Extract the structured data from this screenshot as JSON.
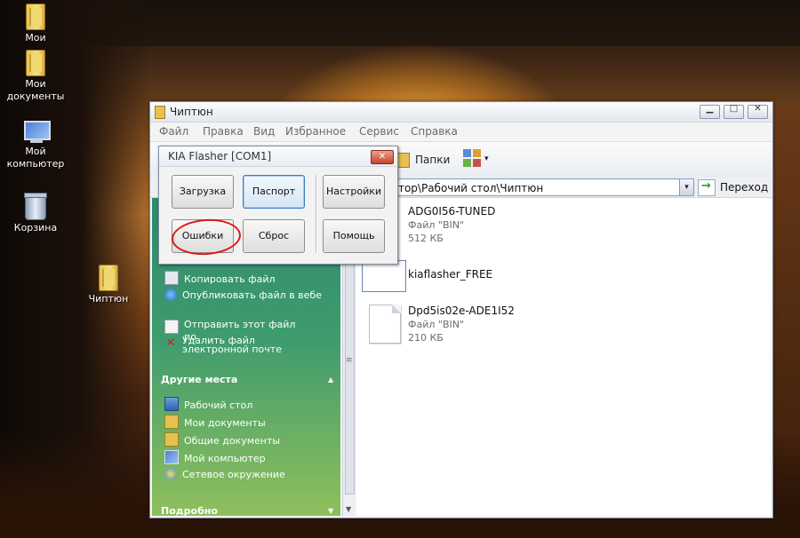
{
  "desktop": {
    "icons": [
      {
        "label": "Мои",
        "icon": "folder-icon"
      },
      {
        "label": "Мои документы",
        "icon": "folder-icon"
      },
      {
        "label": "Мой компьютер",
        "icon": "computer-icon"
      },
      {
        "label": "Корзина",
        "icon": "recycle-bin-icon"
      },
      {
        "label": "Чиптюн",
        "icon": "folder-icon"
      }
    ]
  },
  "explorer": {
    "title": "Чиптюн",
    "caption_buttons": {
      "minimize": "▁",
      "maximize": "□",
      "close": "✕"
    },
    "menu": [
      "Файл",
      "Правка",
      "Вид",
      "Избранное",
      "Сервис",
      "Справка"
    ],
    "toolbar": {
      "folders_label": "Папки",
      "views_icon": "views-icon",
      "views_arrow": "▾"
    },
    "address": {
      "value": "тратор\\Рабочий стол\\Чиптюн",
      "go_label": "Переход",
      "go_icon": "→",
      "dropdown": "▾"
    },
    "task_pane": {
      "file_tasks": [
        {
          "label": "Копировать файл",
          "icon": "copy-icon"
        },
        {
          "label": "Опубликовать файл в вебе",
          "icon": "web-publish-icon"
        },
        {
          "label": "Отправить этот файл по\nэлектронной почте",
          "icon": "email-icon"
        },
        {
          "label": "Удалить файл",
          "icon": "delete-icon"
        }
      ],
      "other_places_title": "Другие места",
      "other_places": [
        {
          "label": "Рабочий стол",
          "icon": "desktop-icon"
        },
        {
          "label": "Мои документы",
          "icon": "folder-icon"
        },
        {
          "label": "Общие документы",
          "icon": "folder-icon"
        },
        {
          "label": "Мой компьютер",
          "icon": "computer-icon"
        },
        {
          "label": "Сетевое окружение",
          "icon": "network-icon"
        }
      ],
      "details_title": "Подробно",
      "caret_up": "▲",
      "caret_down": "▼"
    },
    "scrollbar": {
      "up": "▲",
      "grip": "≡",
      "down": "▼"
    },
    "files": [
      {
        "name": "ADG0I56-TUNED",
        "type": "Файл \"BIN\"",
        "size": "512 КБ"
      },
      {
        "name": "kiaflasher_FREE",
        "type": "",
        "size": ""
      },
      {
        "name": "Dpd5is02e-ADE1I52",
        "type": "Файл \"BIN\"",
        "size": "210 КБ"
      }
    ]
  },
  "kia_dialog": {
    "title": "KIA Flasher [COM1]",
    "close": "✕",
    "buttons": {
      "load": "Загрузка",
      "passport": "Паспорт",
      "settings": "Настройки",
      "errors": "Ошибки",
      "reset": "Сброс",
      "help": "Помощь"
    },
    "highlight_color": "#e01818"
  }
}
